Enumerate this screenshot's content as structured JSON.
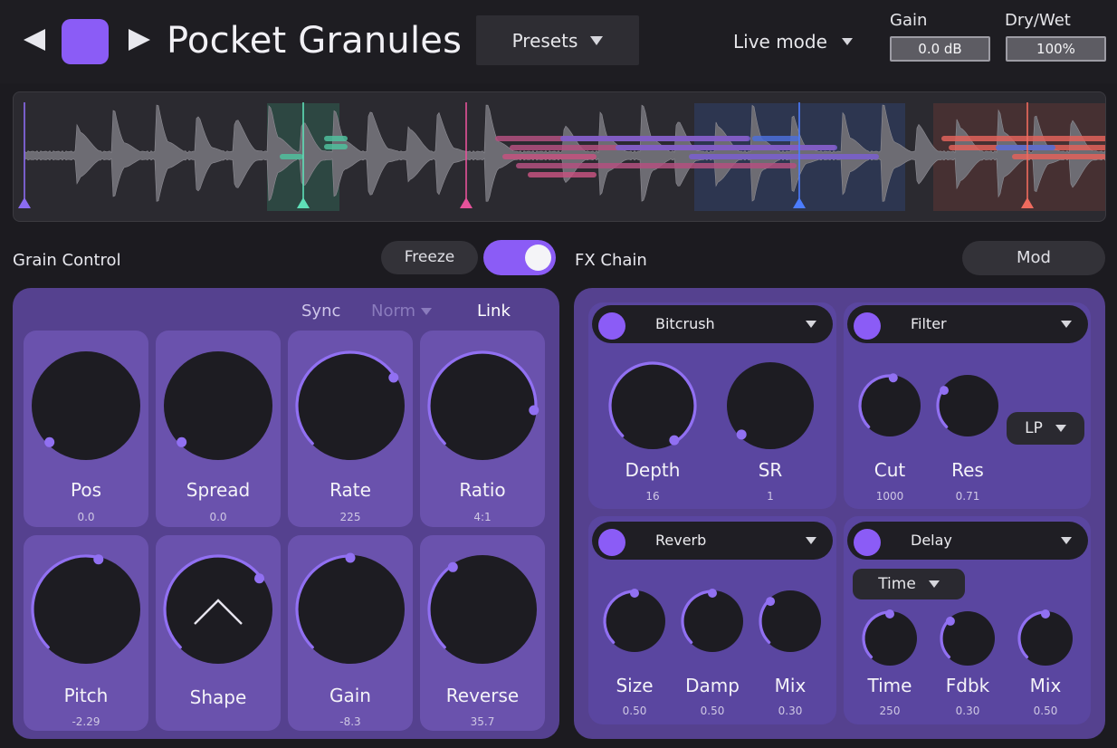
{
  "header": {
    "title": "Pocket Granules",
    "presets_label": "Presets",
    "live_mode_label": "Live mode",
    "gain_label": "Gain",
    "gain_value": "0.0 dB",
    "drywet_label": "Dry/Wet",
    "drywet_value": "100%"
  },
  "colors": {
    "accent": "#8b5cf6",
    "panel": "#55418f",
    "cell": "#6a52ad",
    "marker_green": "#5fe0b8",
    "marker_pink": "#e6529a",
    "marker_blue": "#4c7dff",
    "marker_red": "#ef6b5e"
  },
  "grain_control": {
    "title": "Grain Control",
    "freeze_label": "Freeze",
    "freeze_on": true,
    "sync_label": "Sync",
    "norm_label": "Norm",
    "link_label": "Link",
    "knobs": [
      {
        "label": "Pos",
        "value": "0.0"
      },
      {
        "label": "Spread",
        "value": "0.0"
      },
      {
        "label": "Rate",
        "value": "225"
      },
      {
        "label": "Ratio",
        "value": "4:1"
      },
      {
        "label": "Pitch",
        "value": "-2.29"
      },
      {
        "label": "Shape",
        "value": ""
      },
      {
        "label": "Gain",
        "value": "-8.3"
      },
      {
        "label": "Reverse",
        "value": "35.7"
      }
    ]
  },
  "fx_chain": {
    "title": "FX Chain",
    "mod_label": "Mod",
    "bitcrush": {
      "name": "Bitcrush",
      "knobs": [
        {
          "label": "Depth",
          "value": "16"
        },
        {
          "label": "SR",
          "value": "1"
        }
      ]
    },
    "filter": {
      "name": "Filter",
      "type": "LP",
      "knobs": [
        {
          "label": "Cut",
          "value": "1000"
        },
        {
          "label": "Res",
          "value": "0.71"
        }
      ]
    },
    "reverb": {
      "name": "Reverb",
      "knobs": [
        {
          "label": "Size",
          "value": "0.50"
        },
        {
          "label": "Damp",
          "value": "0.50"
        },
        {
          "label": "Mix",
          "value": "0.30"
        }
      ]
    },
    "delay": {
      "name": "Delay",
      "mode": "Time",
      "knobs": [
        {
          "label": "Time",
          "value": "250"
        },
        {
          "label": "Fdbk",
          "value": "0.30"
        },
        {
          "label": "Mix",
          "value": "0.50"
        }
      ]
    }
  }
}
